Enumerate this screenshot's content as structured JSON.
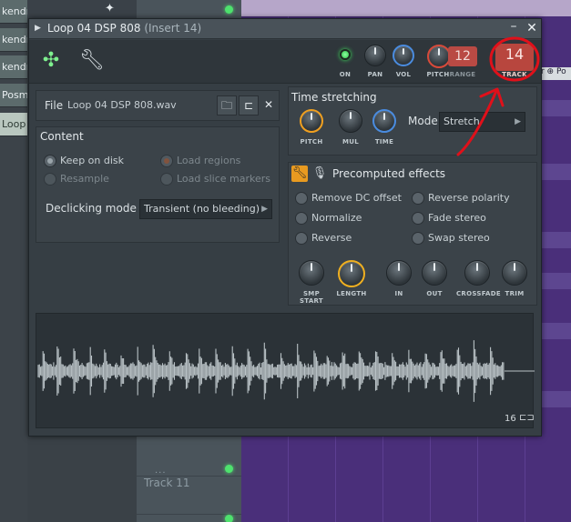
{
  "background": {
    "left_clips": [
      {
        "label": "kendra morris - catc..."
      },
      {
        "label": "kendra"
      },
      {
        "label": "kendra"
      },
      {
        "label": "Posm"
      },
      {
        "label": "Loop"
      }
    ],
    "track11_label": "Track 11",
    "dots": "...",
    "right_lane_label": "r ⊕ Po"
  },
  "window": {
    "title": "Loop 04 DSP 808",
    "insert": "(Insert 14)",
    "minimize_label": "–",
    "close_label": "✕"
  },
  "toolbar": {
    "on_label": "ON",
    "pan_label": "PAN",
    "vol_label": "VOL",
    "pitch_label": "PITCH",
    "range_label": "RANGE",
    "range_value": "12",
    "track_label": "TRACK",
    "track_value": "14"
  },
  "file": {
    "label": "File",
    "name": "Loop 04 DSP 808.wav"
  },
  "content": {
    "title": "Content",
    "keep_on_disk": "Keep on disk",
    "resample": "Resample",
    "load_regions": "Load regions",
    "load_slice_markers": "Load slice markers",
    "declicking_label": "Declicking mode",
    "declicking_value": "Transient (no bleeding)"
  },
  "time_stretching": {
    "title": "Time stretching",
    "pitch_label": "PITCH",
    "mul_label": "MUL",
    "time_label": "TIME",
    "mode_label": "Mode",
    "mode_value": "Stretch"
  },
  "precomputed": {
    "title": "Precomputed effects",
    "options": [
      {
        "label": "Remove DC offset"
      },
      {
        "label": "Reverse polarity"
      },
      {
        "label": "Normalize"
      },
      {
        "label": "Fade stereo"
      },
      {
        "label": "Reverse"
      },
      {
        "label": "Swap stereo"
      }
    ],
    "knobs": [
      {
        "label": "SMP START"
      },
      {
        "label": "LENGTH"
      },
      {
        "label": "IN"
      },
      {
        "label": "OUT"
      },
      {
        "label": "CROSSFADE"
      },
      {
        "label": "TRIM"
      }
    ]
  },
  "waveform": {
    "count": "16",
    "wave_color": "#b9c2c6"
  },
  "colors": {
    "accent_green": "#7ef08e",
    "track_red": "#b8463e",
    "annotation_red": "#e0101a"
  }
}
